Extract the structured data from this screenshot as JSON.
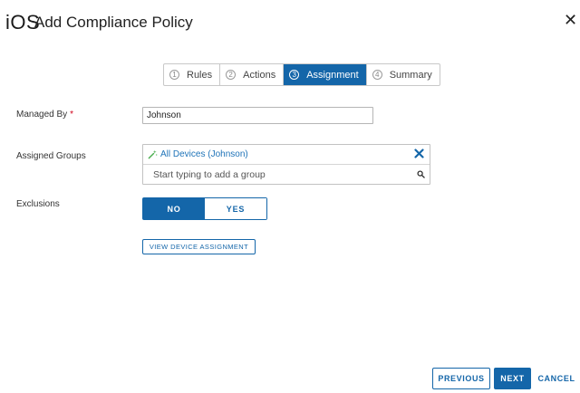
{
  "header": {
    "platform": "iOS",
    "title": "Add Compliance Policy",
    "close_glyph": "✕"
  },
  "wizard": {
    "steps": [
      {
        "number": "1",
        "label": "Rules",
        "active": false
      },
      {
        "number": "2",
        "label": "Actions",
        "active": false
      },
      {
        "number": "3",
        "label": "Assignment",
        "active": true
      },
      {
        "number": "4",
        "label": "Summary",
        "active": false
      }
    ]
  },
  "form": {
    "managed_by": {
      "label": "Managed By",
      "required_marker": "*",
      "value": "Johnson"
    },
    "assigned_groups": {
      "label": "Assigned Groups",
      "chips": [
        {
          "label": "All Devices (Johnson)",
          "icon": "smart-group-wand-icon"
        }
      ],
      "search_placeholder": "Start typing to add a group",
      "search_icon": "search-icon"
    },
    "exclusions": {
      "label": "Exclusions",
      "options": [
        "NO",
        "YES"
      ],
      "selected": "NO"
    },
    "view_device_assignment_label": "VIEW DEVICE ASSIGNMENT"
  },
  "footer": {
    "previous_label": "PREVIOUS",
    "next_label": "NEXT",
    "cancel_label": "CANCEL"
  },
  "colors": {
    "accent": "#1466a9",
    "chip_text": "#1e73b8",
    "required": "#d0021b"
  }
}
